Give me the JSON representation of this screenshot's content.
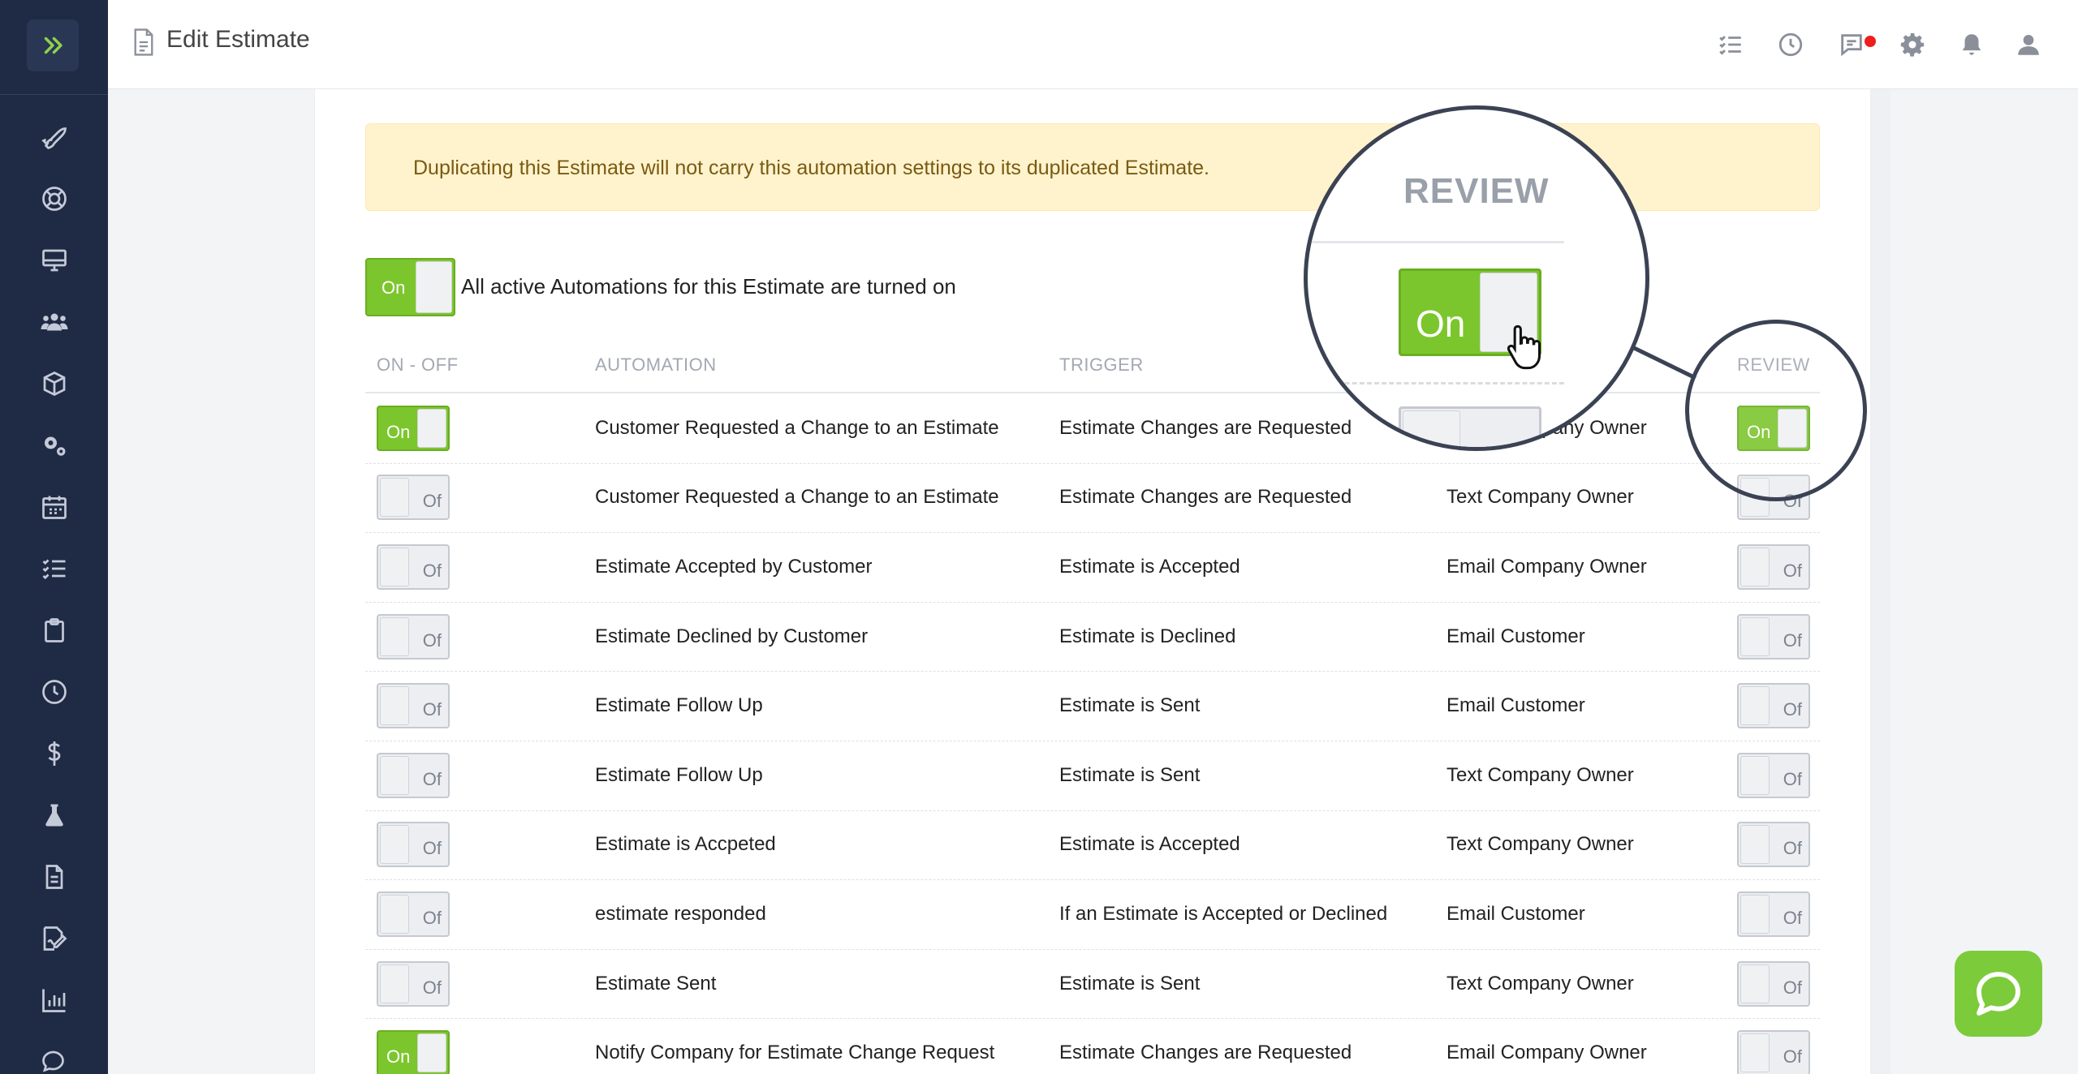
{
  "header": {
    "title": "Edit Estimate"
  },
  "alert": {
    "text": "Duplicating this Estimate will not carry this automation settings to its duplicated Estimate."
  },
  "master": {
    "toggle_label": "On",
    "text": "All active Automations for this Estimate are turned on"
  },
  "columns": {
    "onoff": "ON - OFF",
    "automation": "AUTOMATION",
    "trigger": "TRIGGER",
    "review": "REVIEW"
  },
  "toggle_labels": {
    "on": "On",
    "off": "Of"
  },
  "rows": [
    {
      "on": true,
      "automation": "Customer Requested a Change to an Estimate",
      "trigger": "Estimate Changes are Requested",
      "action": "Email Company Owner",
      "review": true
    },
    {
      "on": false,
      "automation": "Customer Requested a Change to an Estimate",
      "trigger": "Estimate Changes are Requested",
      "action": "Text Company Owner",
      "review": false
    },
    {
      "on": false,
      "automation": "Estimate Accepted by Customer",
      "trigger": "Estimate is Accepted",
      "action": "Email Company Owner",
      "review": false
    },
    {
      "on": false,
      "automation": "Estimate Declined by Customer",
      "trigger": "Estimate is Declined",
      "action": "Email Customer",
      "review": false
    },
    {
      "on": false,
      "automation": "Estimate Follow Up",
      "trigger": "Estimate is Sent",
      "action": "Email Customer",
      "review": false
    },
    {
      "on": false,
      "automation": "Estimate Follow Up",
      "trigger": "Estimate is Sent",
      "action": "Text Company Owner",
      "review": false
    },
    {
      "on": false,
      "automation": "Estimate is Accpeted",
      "trigger": "Estimate is Accepted",
      "action": "Text Company Owner",
      "review": false
    },
    {
      "on": false,
      "automation": "estimate responded",
      "trigger": "If an Estimate is Accepted or Declined",
      "action": "Email Customer",
      "review": false
    },
    {
      "on": false,
      "automation": "Estimate Sent",
      "trigger": "Estimate is Sent",
      "action": "Text Company Owner",
      "review": false
    },
    {
      "on": true,
      "automation": "Notify Company for Estimate Change Request",
      "trigger": "Estimate Changes are Requested",
      "action": "Email Company Owner",
      "review": false
    }
  ],
  "magnifier": {
    "heading": "REVIEW",
    "toggle_label": "On"
  },
  "sidebar": {
    "icons": [
      "rocket-icon",
      "lifebuoy-icon",
      "monitor-icon",
      "users-icon",
      "box-icon",
      "gears-icon",
      "calendar-icon",
      "checklist-icon",
      "clipboard-icon",
      "clock-icon",
      "dollar-icon",
      "flask-icon",
      "document-icon",
      "signature-icon",
      "bar-chart-icon",
      "chat-icon"
    ]
  },
  "colors": {
    "sidebar": "#1f2a44",
    "accent": "#7cc62d",
    "alert_bg": "#fff3cd",
    "alert_text": "#7a5a12",
    "notification": "#f01d1d"
  }
}
